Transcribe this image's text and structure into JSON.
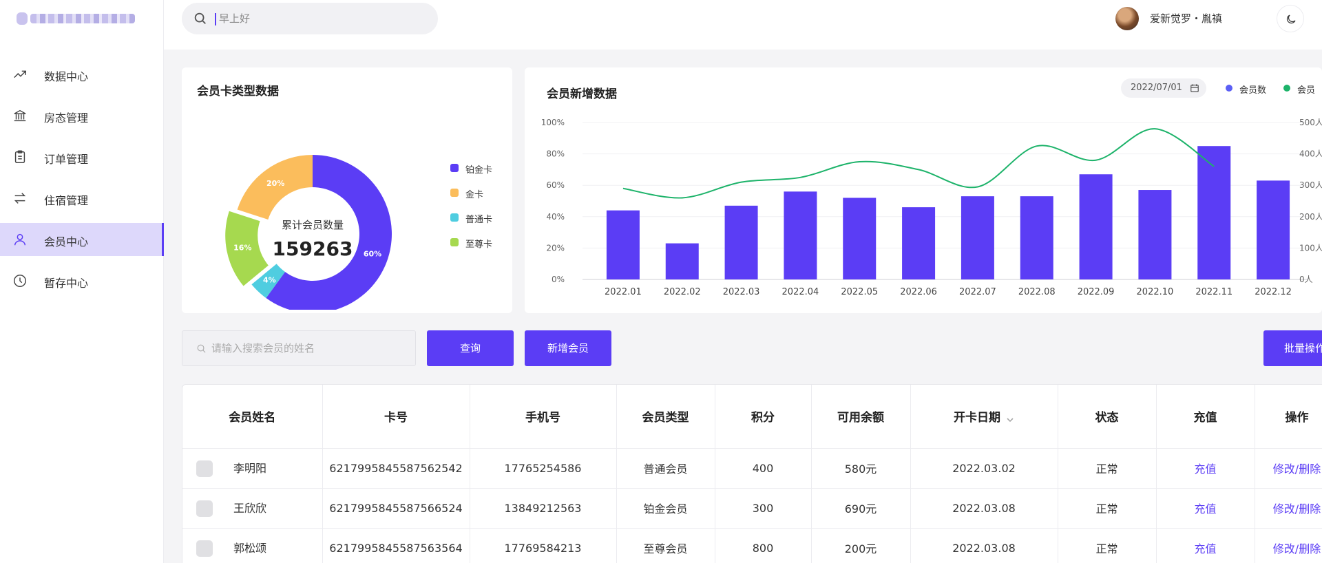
{
  "sidebar": {
    "items": [
      {
        "label": "数据中心",
        "icon": "trend-icon"
      },
      {
        "label": "房态管理",
        "icon": "building-icon"
      },
      {
        "label": "订单管理",
        "icon": "clipboard-icon"
      },
      {
        "label": "住宿管理",
        "icon": "swap-icon"
      },
      {
        "label": "会员中心",
        "icon": "user-icon",
        "active": true
      },
      {
        "label": "暂存中心",
        "icon": "clock-icon"
      }
    ]
  },
  "header": {
    "search_placeholder": "早上好",
    "username": "爱新觉罗・胤禛"
  },
  "pie_card": {
    "title": "会员卡类型数据",
    "center_label": "累计会员数量",
    "center_value": "159263",
    "slices": [
      {
        "label": "铂金卡",
        "pct": "60%",
        "value": 60,
        "color": "#5b3df5"
      },
      {
        "label": "普通卡",
        "pct": "4%",
        "value": 4,
        "color": "#4fcde0"
      },
      {
        "label": "至尊卡",
        "pct": "16%",
        "value": 16,
        "color": "#a6d94f"
      },
      {
        "label": "金卡",
        "pct": "20%",
        "value": 20,
        "color": "#fbbd5c"
      }
    ],
    "legend": [
      "铂金卡",
      "金卡",
      "普通卡",
      "至尊卡"
    ]
  },
  "bar_card": {
    "title": "会员新增数据",
    "date": "2022/07/01",
    "legend": [
      {
        "label": "会员数",
        "color": "#5b5ff5"
      },
      {
        "label": "会员",
        "color": "#1db36a"
      }
    ]
  },
  "chart_data": {
    "type": "bar",
    "categories": [
      "2022.01",
      "2022.02",
      "2022.03",
      "2022.04",
      "2022.05",
      "2022.06",
      "2022.07",
      "2022.08",
      "2022.09",
      "2022.10",
      "2022.11",
      "2022.12"
    ],
    "series": [
      {
        "name": "会员数",
        "type": "bar",
        "axis": "left",
        "color": "#5b3df5",
        "values": [
          44,
          23,
          47,
          56,
          52,
          46,
          53,
          53,
          67,
          57,
          85,
          63
        ]
      },
      {
        "type": "line",
        "axis": "right",
        "color": "#1db36a",
        "values": [
          290,
          260,
          310,
          325,
          375,
          350,
          295,
          425,
          380,
          480,
          360
        ]
      }
    ],
    "y_left": {
      "ticks": [
        "0%",
        "20%",
        "40%",
        "60%",
        "80%",
        "100%"
      ],
      "range": [
        0,
        100
      ]
    },
    "y_right": {
      "ticks": [
        "0人",
        "100人",
        "200人",
        "300人",
        "400人",
        "500人"
      ],
      "range": [
        0,
        500
      ]
    },
    "grid": true
  },
  "toolbar": {
    "search_placeholder": "请输入搜索会员的姓名",
    "query": "查询",
    "add": "新增会员",
    "batch": "批量操作"
  },
  "table": {
    "headers": [
      "会员姓名",
      "卡号",
      "手机号",
      "会员类型",
      "积分",
      "可用余额",
      "开卡日期",
      "状态",
      "充值",
      "操作"
    ],
    "rows": [
      {
        "name": "李明阳",
        "card": "6217995845587562542",
        "phone": "17765254586",
        "type": "普通会员",
        "points": "400",
        "balance": "580元",
        "date": "2022.03.02",
        "status": "正常",
        "recharge": "充值",
        "action": "修改/删除"
      },
      {
        "name": "王欣欣",
        "card": "6217995845587566524",
        "phone": "13849212563",
        "type": "铂金会员",
        "points": "300",
        "balance": "690元",
        "date": "2022.03.08",
        "status": "正常",
        "recharge": "充值",
        "action": "修改/删除"
      },
      {
        "name": "郭松颂",
        "card": "6217995845587563564",
        "phone": "17769584213",
        "type": "至尊会员",
        "points": "800",
        "balance": "200元",
        "date": "2022.03.08",
        "status": "正常",
        "recharge": "充值",
        "action": "修改/删除"
      }
    ]
  }
}
